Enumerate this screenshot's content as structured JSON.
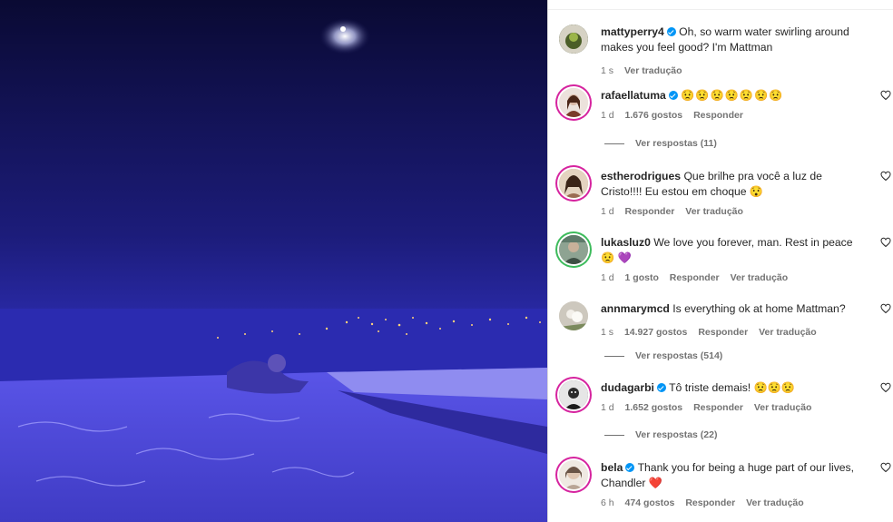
{
  "caption": {
    "user": "mattyperry4",
    "text": "Oh, so warm water swirling around makes you feel good? I'm Mattman",
    "time": "1 s",
    "translate": "Ver tradução"
  },
  "comments": [
    {
      "user": "rafaellatuma",
      "text": "😟😟😟😟😟😟😟",
      "time": "1 d",
      "likes": "1.676 gostos",
      "reply": "Responder",
      "replies": "Ver respostas (11)"
    },
    {
      "user": "estherodrigues",
      "text": "Que brilhe pra você a luz de Cristo!!!! Eu estou em choque 😯",
      "time": "1 d",
      "reply": "Responder",
      "translate": "Ver tradução"
    },
    {
      "user": "lukasluz0",
      "text": "We love you forever, man. Rest in peace 😟",
      "heart_emoji": "💜",
      "time": "1 d",
      "likes": "1 gosto",
      "reply": "Responder",
      "translate": "Ver tradução"
    },
    {
      "user": "annmarymcd",
      "text": "Is everything ok at home Mattman?",
      "time": "1 s",
      "likes": "14.927 gostos",
      "reply": "Responder",
      "translate": "Ver tradução",
      "replies": "Ver respostas (514)"
    },
    {
      "user": "dudagarbi",
      "text": "Tô triste demais! 😟😟😟",
      "time": "1 d",
      "likes": "1.652 gostos",
      "reply": "Responder",
      "translate": "Ver tradução",
      "replies": "Ver respostas (22)"
    },
    {
      "user": "bela",
      "text": "Thank you for being a huge part of our lives, Chandler",
      "heart_emoji": "❤️",
      "time": "6 h",
      "likes": "474 gostos",
      "reply": "Responder",
      "translate": "Ver tradução"
    }
  ],
  "colors": {
    "verified": "#0095f6",
    "muted": "#737373",
    "text": "#262626"
  }
}
